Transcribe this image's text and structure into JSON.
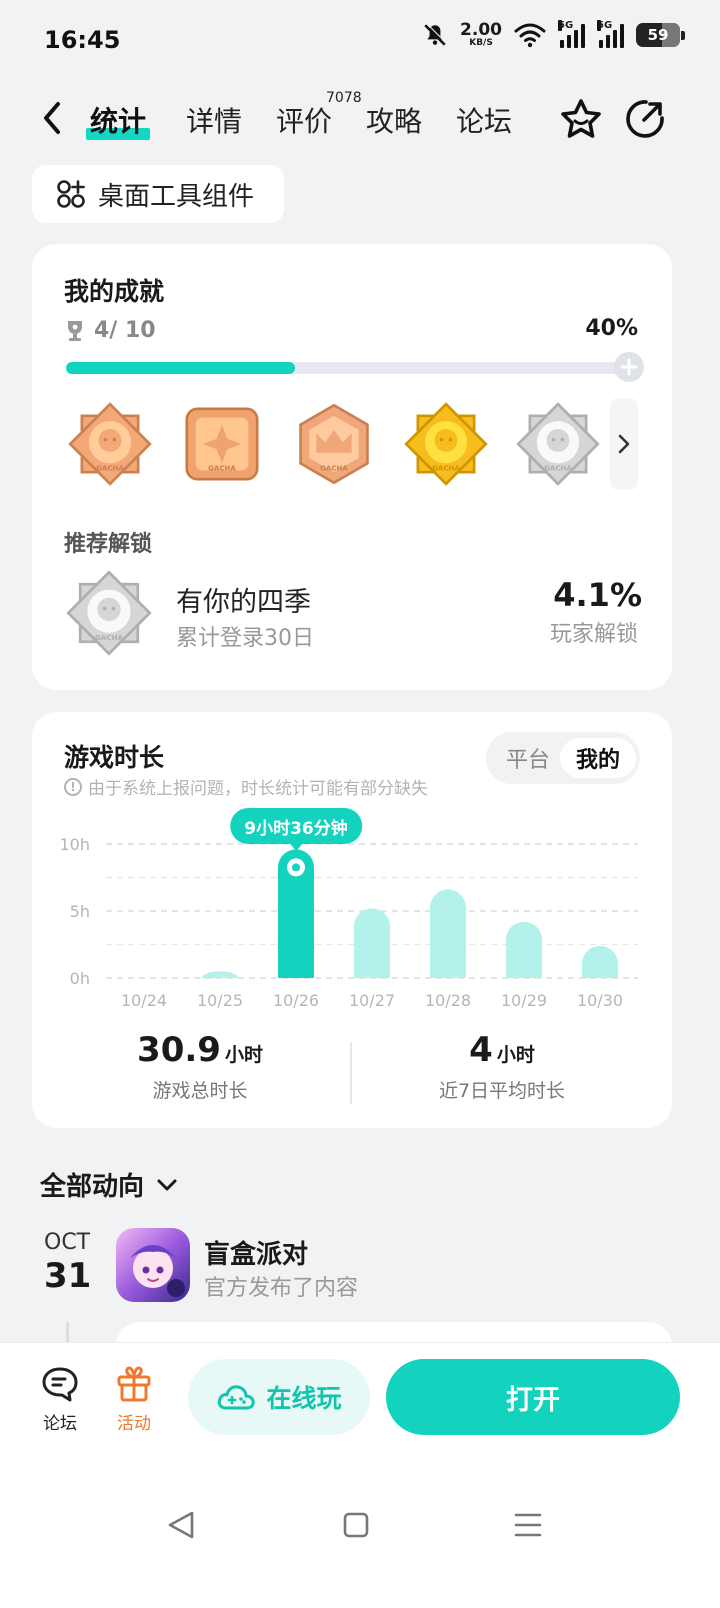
{
  "status": {
    "time": "16:45",
    "speed_value": "2.00",
    "speed_unit": "KB/S",
    "sim1": "5G",
    "sim2": "5G",
    "battery": "59"
  },
  "nav": {
    "tabs": [
      {
        "label": "统计",
        "active": true
      },
      {
        "label": "详情"
      },
      {
        "label": "评价",
        "badge": "7078"
      },
      {
        "label": "攻略"
      },
      {
        "label": "论坛"
      }
    ]
  },
  "widget_chip": {
    "label": "桌面工具组件"
  },
  "achievements": {
    "title": "我的成就",
    "count": "4/ 10",
    "percent": "40%",
    "progress": 0.4,
    "badges": [
      {
        "label": "GACHA",
        "color": "#f3a977",
        "shape": "star8"
      },
      {
        "label": "GACHA",
        "color": "#f0a36d",
        "shape": "square"
      },
      {
        "label": "GACHA",
        "color": "#f0a77a",
        "shape": "hexagon"
      },
      {
        "label": "GACHA",
        "color": "#f7bd1e",
        "shape": "star8"
      },
      {
        "label": "GACHA",
        "color": "#d6d6d6",
        "shape": "star8"
      }
    ],
    "recommend_title": "推荐解锁",
    "recommend": {
      "name": "有你的四季",
      "desc": "累计登录30日",
      "percent": "4.1%",
      "percent_label": "玩家解锁"
    }
  },
  "playtime": {
    "title": "游戏时长",
    "notice": "由于系统上报问题，时长统计可能有部分缺失",
    "toggle": [
      "平台",
      "我的"
    ],
    "toggle_selected": "我的",
    "tooltip": "9小时36分钟",
    "total_value": "30.9",
    "total_unit": "小时",
    "total_label": "游戏总时长",
    "avg_value": "4",
    "avg_unit": "小时",
    "avg_label": "近7日平均时长"
  },
  "chart_data": {
    "type": "bar",
    "categories": [
      "10/24",
      "10/25",
      "10/26",
      "10/27",
      "10/28",
      "10/29",
      "10/30"
    ],
    "values": [
      0,
      0.5,
      9.6,
      5.2,
      6.6,
      4.2,
      2.4
    ],
    "highlight_index": 2,
    "yticks": [
      "0h",
      "5h",
      "10h"
    ],
    "ylim": [
      0,
      10
    ],
    "colors": {
      "highlight": "#13d3bf",
      "bar": "#b3f2ea"
    }
  },
  "feed": {
    "title": "全部动向",
    "month": "OCT",
    "day": "31",
    "app_name": "盲盒派对",
    "app_desc": "官方发布了内容"
  },
  "bottom": {
    "forum_label": "论坛",
    "event_label": "活动",
    "online_label": "在线玩",
    "open_label": "打开"
  }
}
